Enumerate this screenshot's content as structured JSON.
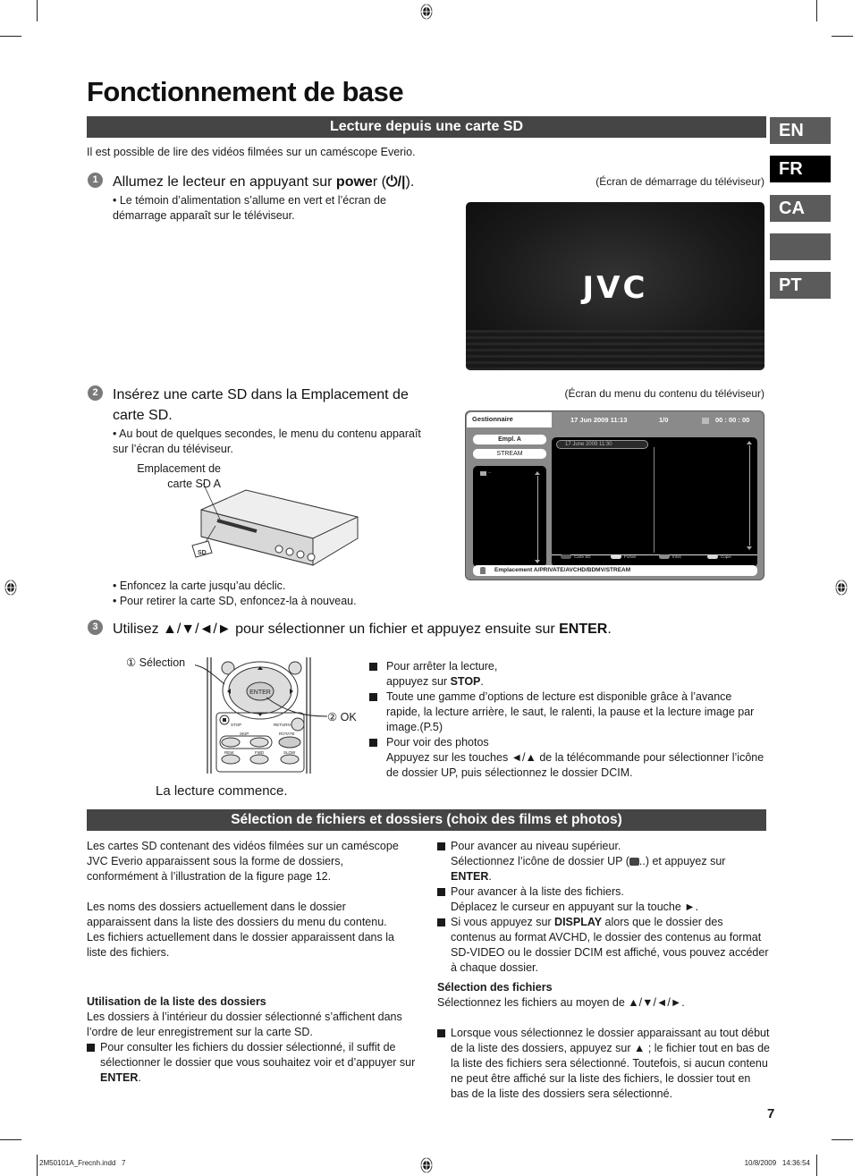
{
  "page": {
    "title": "Fonctionnement de base",
    "page_number": "7",
    "footer_left": "2M50101A_Frecnh.indd   7",
    "footer_right": "10/8/2009   14:36:54"
  },
  "lang_tabs": [
    {
      "code": "EN",
      "active": false
    },
    {
      "code": "FR",
      "active": true
    },
    {
      "code": "CA",
      "active": false
    },
    {
      "code": "",
      "active": false
    },
    {
      "code": "PT",
      "active": false
    }
  ],
  "section1": {
    "heading": "Lecture depuis une carte SD",
    "intro": "Il est possible de lire des vidéos filmées sur un caméscope Everio.",
    "step1": {
      "num": "1",
      "text_pre": "Allumez le lecteur en appuyant sur ",
      "text_bold": "powe",
      "text_mid": "r (",
      "power_symbol": "⏻/|",
      "text_post": ").",
      "bullet": "• Le témoin d’alimentation s’allume en vert et l’écran de démarrage apparaît sur le téléviseur.",
      "screen_caption": "(Écran de démarrage du téléviseur)",
      "screen_logo": "JVC"
    },
    "step2": {
      "num": "2",
      "text": "Insérez une carte SD dans la Emplacement de carte SD.",
      "bullet": "• Au bout de quelques secondes, le menu du contenu apparaît sur l’écran du téléviseur.",
      "slot_label_line1": "Emplacement de",
      "slot_label_line2": "carte SD A",
      "sd_card_label": "SD",
      "bullets_after": [
        "• Enfoncez la carte jusqu’au déclic.",
        "• Pour retirer la carte SD, enfoncez-la à nouveau."
      ],
      "screen_caption": "(Écran du menu du contenu du téléviseur)",
      "menu": {
        "tab": "Gestionnaire",
        "date": "17 Jun 2009 11:13",
        "count": "1/0",
        "time": "00 : 00 : 00",
        "location": "Empl. A",
        "folder": "STREAM",
        "up_folder": "..",
        "file_item": "17 June 2009 11:30",
        "keys": [
          {
            "label": "Carte SD",
            "color": "#5a5a5a"
          },
          {
            "label": "Fichier",
            "color": "#e0e0e0"
          },
          {
            "label": "Infos",
            "color": "#8a8a8a"
          },
          {
            "label": "Copie",
            "color": "#d8d8d8"
          }
        ],
        "path": "Emplacement A/PRIVATE/AVCHD/BDMV/STREAM"
      }
    },
    "step3": {
      "num": "3",
      "text_pre": "Utilisez ▲/▼/◄/► pour sélectionner un fichier et appuyez ensuite sur ",
      "text_bold": "ENTER",
      "text_post": ".",
      "remote": {
        "callout1": "① Sélection",
        "callout2": "② OK",
        "enter": "ENTER",
        "stop": "STOP",
        "return": "RETURN",
        "skip": "SKIP",
        "rotate": "ROTATE",
        "rew": "REW",
        "fwd": "FWD",
        "slow": "SLOW"
      },
      "result": "La lecture commence.",
      "notes": [
        {
          "pre": "Pour arrêter la lecture,",
          "line2_pre": "appuyez sur ",
          "bold": "STOP",
          "post": "."
        },
        {
          "text": "Toute une gamme d’options de lecture est disponible grâce à l’avance rapide, la lecture arrière, le saut, le ralenti, la pause et la lecture image par image.(P.5)"
        },
        {
          "pre": "Pour voir des photos",
          "text": "Appuyez sur les touches ◄/▲ de la télécommande pour sélectionner l’icône de dossier UP, puis sélectionnez le dossier DCIM."
        }
      ]
    }
  },
  "section2": {
    "heading": "Sélection de fichiers et dossiers (choix des films et photos)",
    "left": {
      "para1": "Les cartes SD contenant des vidéos filmées sur un caméscope JVC Everio apparaissent sous la forme de dossiers, conformément à l’illustration de la figure page 12.",
      "para2": "Les noms des dossiers actuellement dans le dossier apparaissent dans la liste des dossiers du menu du contenu.",
      "para3": "Les fichiers actuellement dans le dossier apparaissent dans la liste des fichiers.",
      "subheading": "Utilisation de la liste des dossiers",
      "para4": "Les dossiers à l’intérieur du dossier sélectionné s’affichent dans l’ordre de leur enregistrement sur la carte SD.",
      "item1_pre": "Pour consulter les fichiers du dossier sélectionné, il suffit de sélectionner le dossier que vous souhaitez voir et d’appuyer sur ",
      "item1_bold": "ENTER",
      "item1_post": "."
    },
    "right": {
      "item1_line1": "Pour avancer au niveau supérieur.",
      "item1_pre": "Sélectionnez l’icône de dossier UP (",
      "item1_icon_text": "..",
      "item1_mid": ") et appuyez sur ",
      "item1_bold": "ENTER",
      "item1_post": ".",
      "item2_line1": "Pour avancer à la liste des fichiers.",
      "item2_line2": "Déplacez le curseur en appuyant sur la touche ►.",
      "item3_pre": "Si vous appuyez sur ",
      "item3_bold": "DISPLAY",
      "item3_post": " alors que le dossier des contenus au format AVCHD, le dossier des contenus au format SD-VIDEO ou le dossier DCIM est affiché, vous pouvez accéder à chaque dossier.",
      "subheading": "Sélection des fichiers",
      "para": "Sélectionnez les fichiers au moyen de ▲/▼/◄/►.",
      "item4": "Lorsque vous sélectionnez le dossier apparaissant au tout début de la liste des dossiers, appuyez sur ▲ ; le fichier tout en bas de la liste des fichiers sera sélectionné. Toutefois, si aucun contenu ne peut être affiché sur la liste des fichiers, le dossier tout en bas de la liste des dossiers sera sélectionné."
    }
  }
}
